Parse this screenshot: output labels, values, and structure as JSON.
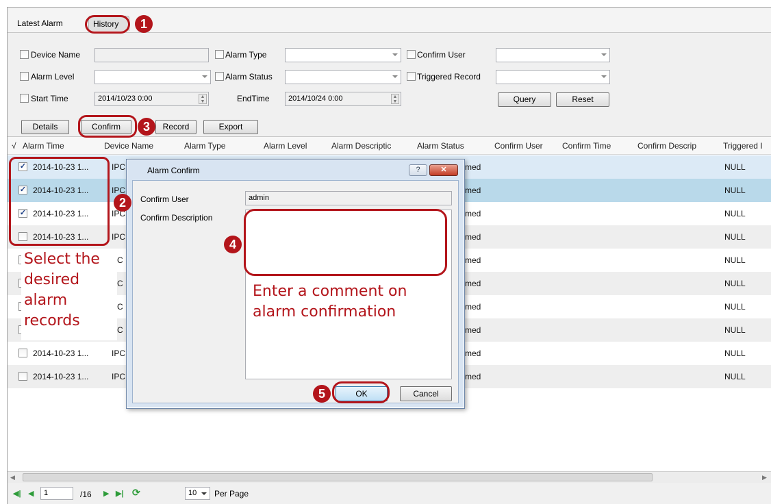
{
  "tabs": {
    "latest": "Latest Alarm",
    "history": "History"
  },
  "filters": {
    "device_name": "Device Name",
    "alarm_type": "Alarm Type",
    "confirm_user": "Confirm User",
    "alarm_level": "Alarm Level",
    "alarm_status": "Alarm Status",
    "triggered_record": "Triggered Record",
    "start_time": "Start Time",
    "start_value": "2014/10/23 0:00",
    "end_time": "EndTime",
    "end_value": "2014/10/24 0:00",
    "query": "Query",
    "reset": "Reset"
  },
  "toolbar": {
    "details": "Details",
    "confirm": "Confirm",
    "record": "Record",
    "export": "Export"
  },
  "table": {
    "check_header": "√",
    "columns": [
      "Alarm Time",
      "Device Name",
      "Alarm Type",
      "Alarm Level",
      "Alarm Descriptic",
      "Alarm Status",
      "Confirm User",
      "Confirm Time",
      "Confirm Descrip",
      "Triggered I"
    ],
    "rows": [
      {
        "time": "2014-10-23 1...",
        "device": "IPC",
        "status": "med",
        "record": "NULL",
        "checked": true
      },
      {
        "time": "2014-10-23 1...",
        "device": "IPC",
        "status": "med",
        "record": "NULL",
        "checked": true
      },
      {
        "time": "2014-10-23 1...",
        "device": "IPC",
        "status": "med",
        "record": "NULL",
        "checked": true
      },
      {
        "time": "2014-10-23 1...",
        "device": "IPC",
        "status": "med",
        "record": "NULL",
        "checked": false
      },
      {
        "time": "",
        "device": "PC",
        "status": "med",
        "record": "NULL",
        "checked": false
      },
      {
        "time": "",
        "device": "PC",
        "status": "med",
        "record": "NULL",
        "checked": false
      },
      {
        "time": "",
        "device": "PC",
        "status": "med",
        "record": "NULL",
        "checked": false
      },
      {
        "time": "",
        "device": "PC",
        "status": "med",
        "record": "NULL",
        "checked": false
      },
      {
        "time": "2014-10-23 1...",
        "device": "IPC",
        "status": "med",
        "record": "NULL",
        "checked": false
      },
      {
        "time": "2014-10-23 1...",
        "device": "IPC",
        "status": "med",
        "record": "NULL",
        "checked": false
      }
    ]
  },
  "pager": {
    "page_input": "1",
    "total": "/16",
    "per_page_value": "10",
    "per_page_label": "Per Page"
  },
  "dialog": {
    "title": "Alarm Confirm",
    "help": "?",
    "close": "✕",
    "confirm_user_label": "Confirm User",
    "confirm_user_value": "admin",
    "confirm_desc_label": "Confirm Description",
    "ok": "OK",
    "cancel": "Cancel"
  },
  "annotations": {
    "badges": [
      "1",
      "2",
      "3",
      "4",
      "5"
    ],
    "select_note": [
      "Select the",
      "desired",
      "alarm",
      "records"
    ],
    "comment_note": [
      "Enter a comment on",
      "alarm confirmation"
    ]
  },
  "colors": {
    "annotation_red": "#b3151b",
    "selected_row": "#dceaf6",
    "selected_row_alt": "#b9d9ea",
    "alt_row": "#eeeeee"
  }
}
